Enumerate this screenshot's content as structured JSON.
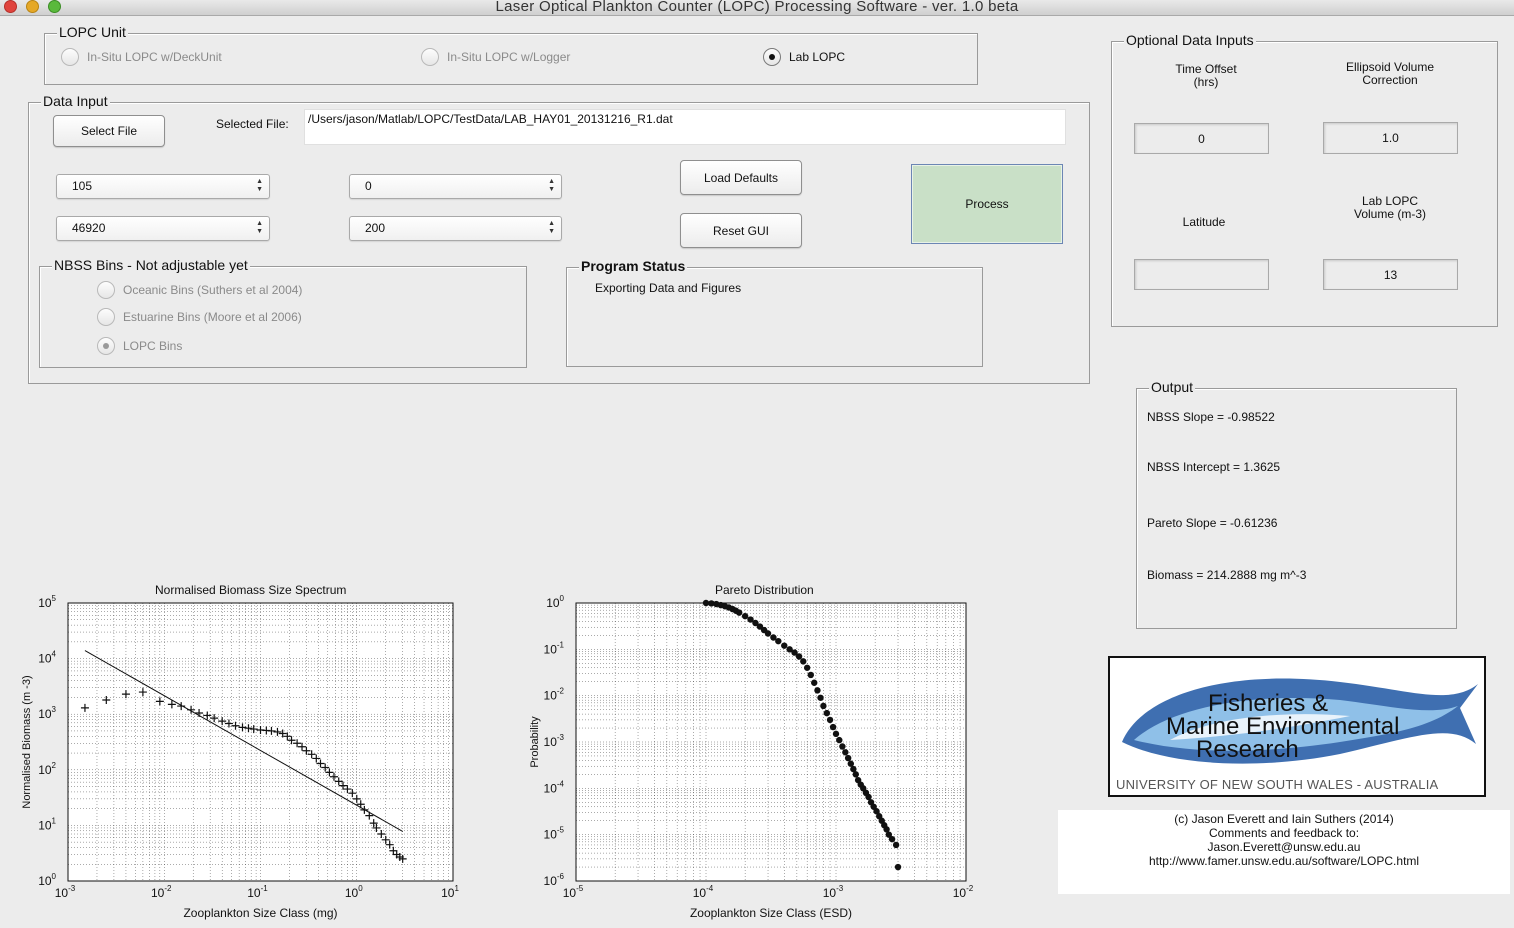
{
  "window": {
    "title": "Laser Optical Plankton Counter (LOPC) Processing Software - ver. 1.0 beta"
  },
  "lopc_unit": {
    "title": "LOPC Unit",
    "options": [
      {
        "label": "In-Situ LOPC w/DeckUnit",
        "selected": false,
        "enabled": false
      },
      {
        "label": "In-Situ LOPC w/Logger",
        "selected": false,
        "enabled": false
      },
      {
        "label": "Lab LOPC",
        "selected": true,
        "enabled": true
      }
    ]
  },
  "data_input": {
    "title": "Data Input",
    "select_file_label": "Select File",
    "selected_file_label": "Selected File:",
    "selected_file_value": "/Users/jason/Matlab/LOPC/TestData/LAB_HAY01_20131216_R1.dat",
    "selects": [
      "105",
      "0",
      "46920",
      "200"
    ],
    "load_defaults_label": "Load Defaults",
    "reset_gui_label": "Reset GUI",
    "process_label": "Process"
  },
  "nbss_bins": {
    "title": "NBSS Bins - Not adjustable yet",
    "options": [
      {
        "label": "Oceanic Bins (Suthers et al 2004)",
        "selected": false
      },
      {
        "label": "Estuarine Bins (Moore et al 2006)",
        "selected": false
      },
      {
        "label": "LOPC Bins",
        "selected": true
      }
    ]
  },
  "program_status": {
    "title": "Program Status",
    "text": "Exporting Data and Figures"
  },
  "optional_inputs": {
    "title": "Optional Data Inputs",
    "time_offset_label_1": "Time Offset",
    "time_offset_label_2": "(hrs)",
    "time_offset_value": "0",
    "ellipsoid_label_1": "Ellipsoid Volume",
    "ellipsoid_label_2": "Correction",
    "ellipsoid_value": "1.0",
    "latitude_label": "Latitude",
    "latitude_value": "",
    "lab_volume_label_1": "Lab LOPC",
    "lab_volume_label_2": "Volume (m-3)",
    "lab_volume_value": "13"
  },
  "output": {
    "title": "Output",
    "nbss_slope": "NBSS Slope = -0.98522",
    "nbss_intercept": "NBSS Intercept = 1.3625",
    "pareto_slope": "Pareto Slope = -0.61236",
    "biomass": "Biomass = 214.2888 mg m^-3"
  },
  "logo": {
    "line1": "Fisheries &",
    "line2": "Marine Environmental",
    "line3": "Research",
    "university": "UNIVERSITY OF NEW SOUTH WALES - AUSTRALIA"
  },
  "credits": {
    "line1": "(c) Jason Everett and Iain Suthers (2014)",
    "line2": "Comments and feedback to:",
    "line3": "Jason.Everett@unsw.edu.au",
    "line4": "http://www.famer.unsw.edu.au/software/LOPC.html"
  },
  "colors": {
    "window_bg": "#ececec",
    "process_button": "#c9e0c7",
    "logo_blue": "#2a5fa8"
  },
  "chart_data": [
    {
      "type": "scatter",
      "title": "Normalised Biomass Size Spectrum",
      "xlabel": "Zooplankton Size Class (mg)",
      "ylabel": "Normalised Biomass (m -3)",
      "x_scale": "log",
      "y_scale": "log",
      "xlim": [
        0.001,
        10
      ],
      "ylim": [
        1,
        100000
      ],
      "x_ticks": [
        "10-3",
        "10-2",
        "10-1",
        "100",
        "101"
      ],
      "y_ticks": [
        "100",
        "101",
        "102",
        "103",
        "104",
        "105"
      ],
      "grid": true,
      "series": [
        {
          "marker": "+",
          "x": [
            0.0015,
            0.0025,
            0.004,
            0.006,
            0.009,
            0.012,
            0.015,
            0.019,
            0.023,
            0.028,
            0.033,
            0.04,
            0.047,
            0.055,
            0.065,
            0.075,
            0.085,
            0.1,
            0.115,
            0.13,
            0.15,
            0.17,
            0.19,
            0.21,
            0.24,
            0.27,
            0.3,
            0.34,
            0.38,
            0.42,
            0.47,
            0.52,
            0.58,
            0.65,
            0.72,
            0.8,
            0.9,
            1.0,
            1.1,
            1.2,
            1.35,
            1.5,
            1.6,
            1.8,
            2.0,
            2.2,
            2.4,
            2.6,
            2.8,
            3.0
          ],
          "y": [
            1300,
            1800,
            2300,
            2500,
            1700,
            1500,
            1400,
            1200,
            1050,
            950,
            850,
            750,
            680,
            620,
            580,
            560,
            540,
            520,
            510,
            500,
            480,
            450,
            400,
            340,
            300,
            260,
            220,
            190,
            160,
            130,
            110,
            90,
            75,
            62,
            52,
            45,
            38,
            30,
            24,
            19,
            15,
            11,
            9,
            7,
            5.5,
            4.5,
            3.5,
            3,
            2.7,
            2.5
          ]
        }
      ],
      "fit_line": {
        "slope": -0.98522,
        "intercept": 1.3625
      }
    },
    {
      "type": "scatter",
      "title": "Pareto Distribution",
      "xlabel": "Zooplankton Size Class (ESD)",
      "ylabel": "Probability",
      "x_scale": "log",
      "y_scale": "log",
      "xlim": [
        1e-05,
        0.01
      ],
      "ylim": [
        1e-06,
        1
      ],
      "x_ticks": [
        "10-5",
        "10-4",
        "10-3",
        "10-2"
      ],
      "y_ticks": [
        "10-6",
        "10-5",
        "10-4",
        "10-3",
        "10-2",
        "10-1",
        "100"
      ],
      "grid": true,
      "series": [
        {
          "marker": "filled-circle",
          "x": [
            0.0001,
            0.00011,
            0.00012,
            0.00013,
            0.00014,
            0.00015,
            0.00016,
            0.00017,
            0.00018,
            0.0002,
            0.00022,
            0.00024,
            0.00026,
            0.00028,
            0.0003,
            0.00033,
            0.00036,
            0.0004,
            0.00044,
            0.00048,
            0.00052,
            0.00056,
            0.0006,
            0.00064,
            0.00068,
            0.00072,
            0.00076,
            0.0008,
            0.00085,
            0.0009,
            0.00095,
            0.001,
            0.00106,
            0.00112,
            0.00118,
            0.00124,
            0.0013,
            0.00136,
            0.00142,
            0.00148,
            0.00155,
            0.00162,
            0.0017,
            0.00178,
            0.00186,
            0.00195,
            0.00205,
            0.00215,
            0.00225,
            0.00235,
            0.00245,
            0.00255,
            0.0027,
            0.0029,
            0.003
          ],
          "y": [
            1.0,
            0.98,
            0.95,
            0.9,
            0.85,
            0.8,
            0.74,
            0.68,
            0.62,
            0.52,
            0.44,
            0.37,
            0.31,
            0.26,
            0.22,
            0.18,
            0.15,
            0.12,
            0.1,
            0.085,
            0.07,
            0.055,
            0.04,
            0.028,
            0.019,
            0.013,
            0.009,
            0.006,
            0.0042,
            0.003,
            0.0021,
            0.0015,
            0.0011,
            0.0008,
            0.0006,
            0.00045,
            0.00034,
            0.00026,
            0.0002,
            0.00015,
            0.00012,
            0.0001,
            8e-05,
            6.5e-05,
            5e-05,
            4e-05,
            3.2e-05,
            2.5e-05,
            2e-05,
            1.6e-05,
            1.3e-05,
            1e-05,
            8e-06,
            6e-06,
            2e-06
          ]
        }
      ]
    }
  ]
}
